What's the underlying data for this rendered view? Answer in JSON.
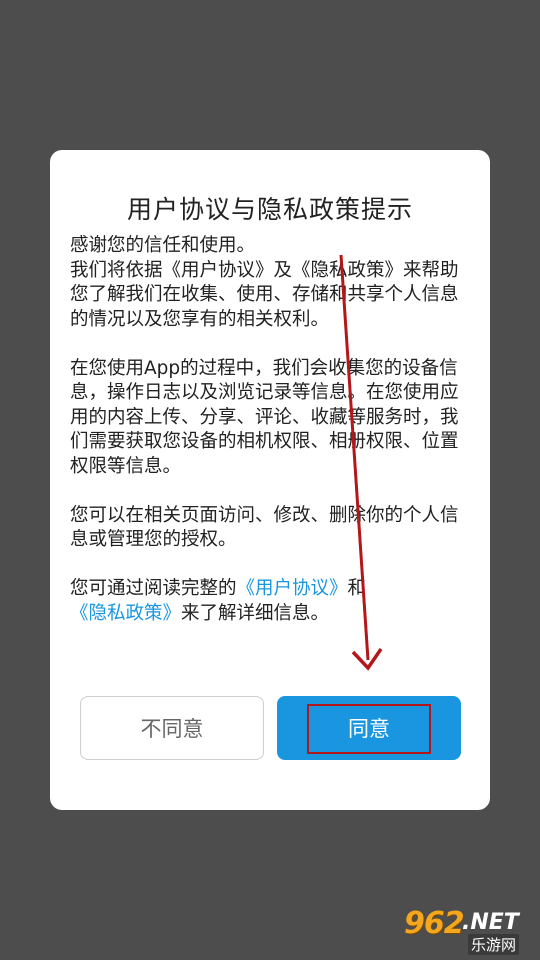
{
  "dialog": {
    "title": "用户协议与隐私政策提示",
    "para1_line1": "感谢您的信任和使用。",
    "para1_rest_a": "我们将依据《用户协议》及《隐私政策》来帮助您了解我们在收集、使用、存储和共享个人信息的情况以及您享有的相关权利。",
    "para2": "在您使用App的过程中，我们会收集您的设备信息，操作日志以及浏览记录等信息。在您使用应用的内容上传、分享、评论、收藏等服务时，我们需要获取您设备的相机权限、相册权限、位置权限等信息。",
    "para3": "您可以在相关页面访问、修改、删除你的个人信息或管理您的授权。",
    "para4_prefix": "您可通过阅读完整的",
    "link_user_agreement": "《用户协议》",
    "para4_and": "和",
    "link_privacy_policy": "《隐私政策》",
    "para4_suffix": "来了解详细信息。",
    "decline_button": "不同意",
    "agree_button": "同意"
  },
  "watermark": {
    "number": "962",
    "domain": ".NET",
    "sub": "乐游网"
  },
  "colors": {
    "accent": "#1a96e0",
    "annotation": "#b3171a",
    "overlay": "#4d4d4d"
  }
}
